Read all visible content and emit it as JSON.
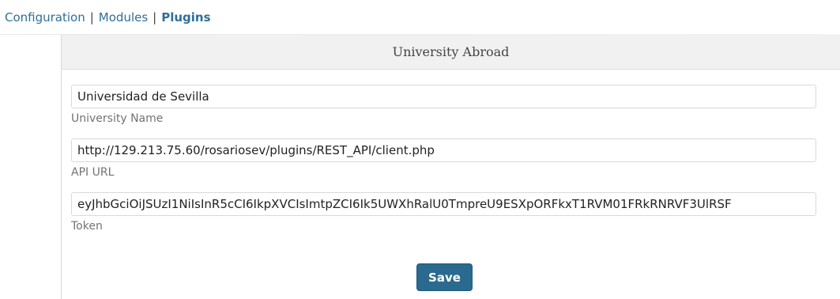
{
  "nav": {
    "items": [
      {
        "label": "Configuration"
      },
      {
        "label": "Modules"
      },
      {
        "label": "Plugins"
      }
    ],
    "separator": "|"
  },
  "panel": {
    "title": "University Abroad"
  },
  "form": {
    "university_name": {
      "value": "Universidad de Sevilla",
      "label": "University Name"
    },
    "api_url": {
      "value": "http://129.213.75.60/rosariosev/plugins/REST_API/client.php",
      "label": "API URL"
    },
    "token": {
      "value": "eyJhbGciOiJSUzI1NiIsInR5cCI6IkpXVCIsImtpZCI6Ik5UWXhRalU0TmpreU9ESXpORFkxT1RVM01FRkRNRVF3UlRSF",
      "label": "Token"
    },
    "save_label": "Save"
  },
  "colors": {
    "link": "#2f6f97",
    "button": "#2b6a8f"
  }
}
